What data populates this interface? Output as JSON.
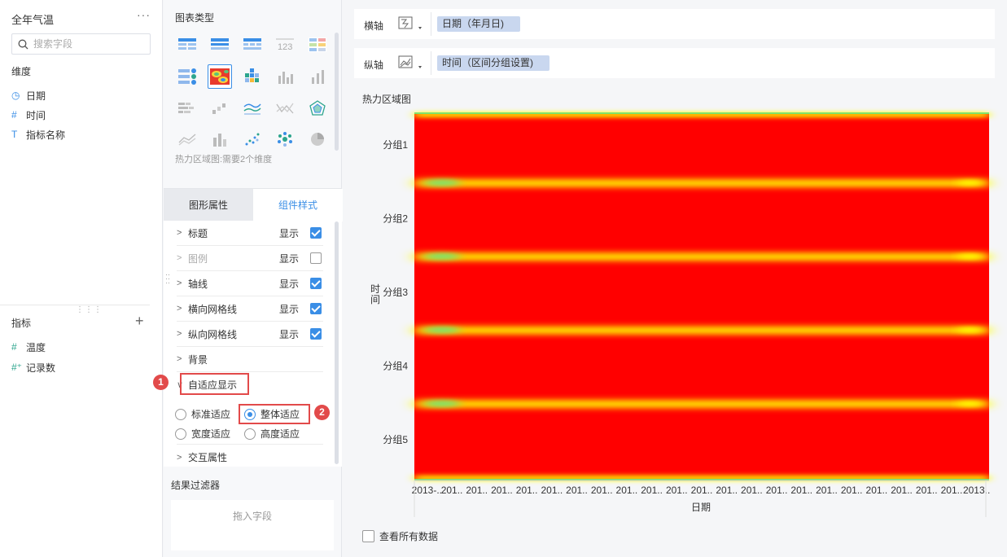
{
  "left_panel": {
    "dataset_title": "全年气温",
    "more_glyph": "···",
    "search_placeholder": "搜索字段",
    "dimension_label": "维度",
    "dimensions": [
      {
        "icon": "clock-icon",
        "glyph": "◷",
        "label": "日期"
      },
      {
        "icon": "number-icon",
        "glyph": "#",
        "label": "时间"
      },
      {
        "icon": "text-icon",
        "glyph": "T",
        "label": "指标名称"
      }
    ],
    "measure_label": "指标",
    "measures": [
      {
        "icon": "number-icon",
        "glyph": "#",
        "label": "温度"
      },
      {
        "icon": "calc-number-icon",
        "glyph": "#⁺",
        "label": "记录数"
      }
    ]
  },
  "middle_panel": {
    "chart_type_title": "图表类型",
    "chart_type_hint": "热力区域图:需要2个维度",
    "tabs": [
      "图形属性",
      "组件样式"
    ],
    "properties": [
      {
        "label": "标题",
        "show_label": "显示",
        "checked": true,
        "dim": false
      },
      {
        "label": "图例",
        "show_label": "显示",
        "checked": false,
        "dim": true
      },
      {
        "label": "轴线",
        "show_label": "显示",
        "checked": true,
        "dim": false
      },
      {
        "label": "横向网格线",
        "show_label": "显示",
        "checked": true,
        "dim": false
      },
      {
        "label": "纵向网格线",
        "show_label": "显示",
        "checked": true,
        "dim": false
      },
      {
        "label": "背景"
      }
    ],
    "adaptive": {
      "label": "自适应显示",
      "options": [
        {
          "label": "标准适应",
          "selected": false
        },
        {
          "label": "整体适应",
          "selected": true
        },
        {
          "label": "宽度适应",
          "selected": false
        },
        {
          "label": "高度适应",
          "selected": false
        }
      ]
    },
    "interaction_label": "交互属性",
    "callouts": [
      "1",
      "2"
    ],
    "filter_title": "结果过滤器",
    "filter_drop_hint": "拖入字段"
  },
  "right_panel": {
    "x_axis_label": "横轴",
    "x_axis_field": "日期（年月日)",
    "y_axis_label": "纵轴",
    "y_axis_field": "时间（区间分组设置)",
    "chart_title": "热力区域图",
    "view_all_label": "查看所有数据"
  },
  "chart_data": {
    "type": "heatmap",
    "title": "热力区域图",
    "xlabel": "日期",
    "ylabel": "时间",
    "y_categories": [
      "分组1",
      "分组2",
      "分组3",
      "分组4",
      "分组5"
    ],
    "x_tick_labels": [
      "2013-..",
      "201..",
      "201..",
      "201..",
      "201..",
      "201..",
      "201..",
      "201..",
      "201..",
      "201..",
      "201..",
      "201..",
      "201..",
      "201..",
      "201..",
      "201..",
      "201..",
      "201..",
      "201..",
      "201..",
      "201..",
      "201..",
      "2013.."
    ],
    "colors": {
      "high": "#ff0000",
      "mid": "#ffff00",
      "low": "#7ee26c"
    }
  }
}
